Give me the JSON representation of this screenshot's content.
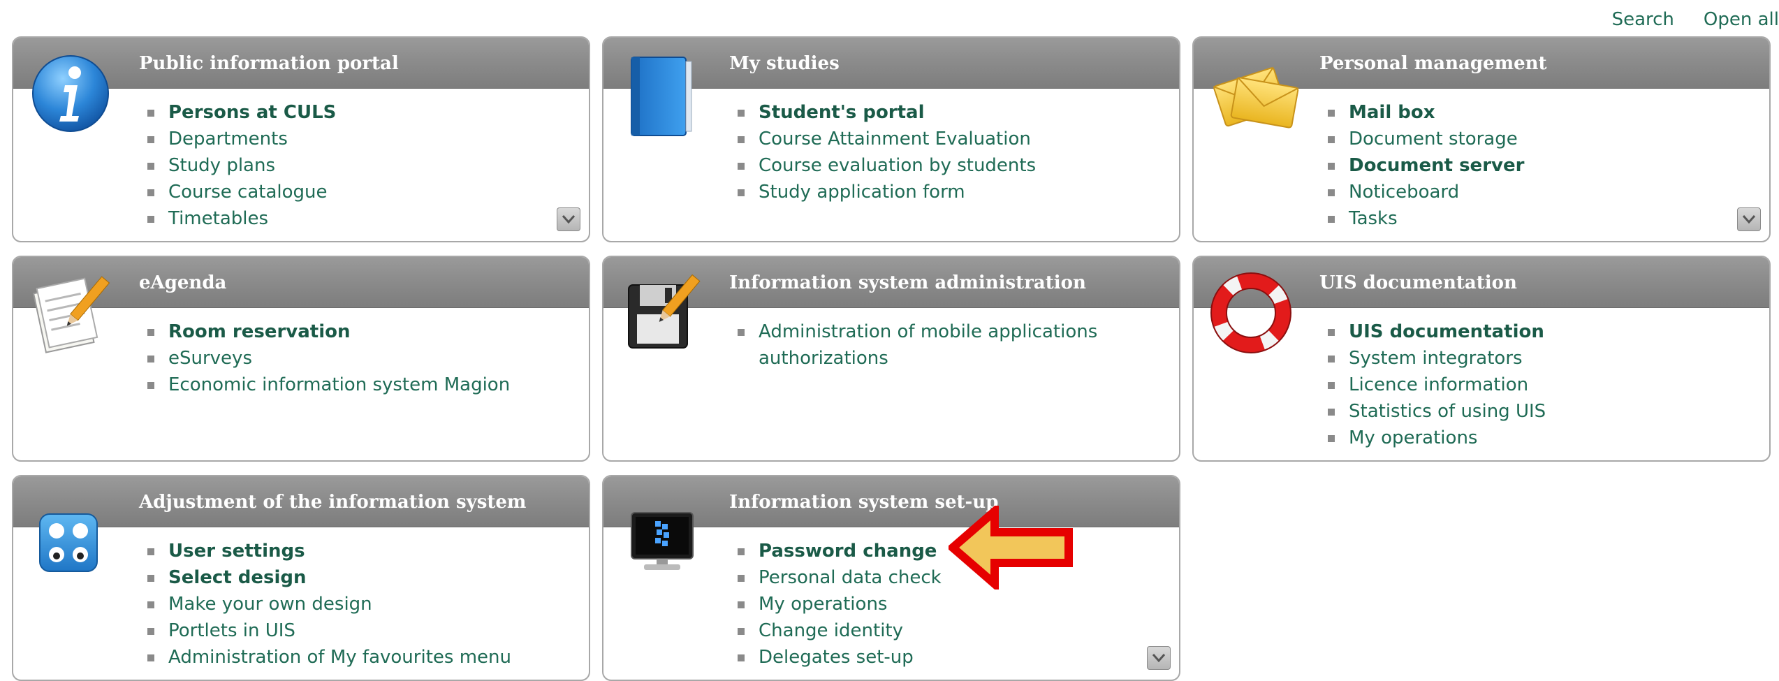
{
  "toplinks": {
    "search": "Search",
    "open_all": "Open all"
  },
  "panels": [
    {
      "title": "Public information portal",
      "items": [
        "Persons at CULS",
        "Departments",
        "Study plans",
        "Course catalogue",
        "Timetables"
      ]
    },
    {
      "title": "My studies",
      "items": [
        "Student's portal",
        "Course Attainment Evaluation",
        "Course evaluation by students",
        "Study application form"
      ]
    },
    {
      "title": "Personal management",
      "items": [
        "Mail box",
        "Document storage",
        "Document server",
        "Noticeboard",
        "Tasks"
      ]
    },
    {
      "title": "eAgenda",
      "items": [
        "Room reservation",
        "eSurveys",
        "Economic information system Magion"
      ]
    },
    {
      "title": "Information system administration",
      "items": [
        "Administration of mobile applications authorizations"
      ]
    },
    {
      "title": "UIS documentation",
      "items": [
        "UIS documentation",
        "System integrators",
        "Licence information",
        "Statistics of using UIS",
        "My operations"
      ]
    },
    {
      "title": "Adjustment of the information system",
      "items": [
        "User settings",
        "Select design",
        "Make your own design",
        "Portlets in UIS",
        "Administration of My favourites menu"
      ]
    },
    {
      "title": "Information system set-up",
      "items": [
        "Password change",
        "Personal data check",
        "My operations",
        "Change identity",
        "Delegates set-up"
      ]
    }
  ],
  "icons": {
    "p0": "info-icon",
    "p1": "notebook-icon",
    "p2": "envelope-icon",
    "p3": "notepad-pencil-icon",
    "p4": "floppy-pencil-icon",
    "p5": "lifebuoy-icon",
    "p6": "switches-icon",
    "p7": "monitor-icon"
  },
  "colors": {
    "link": "#1f6b55",
    "header": "#8c8c8c",
    "highlight_arrow_border": "#e60000",
    "highlight_arrow_fill": "#f2c65a"
  }
}
